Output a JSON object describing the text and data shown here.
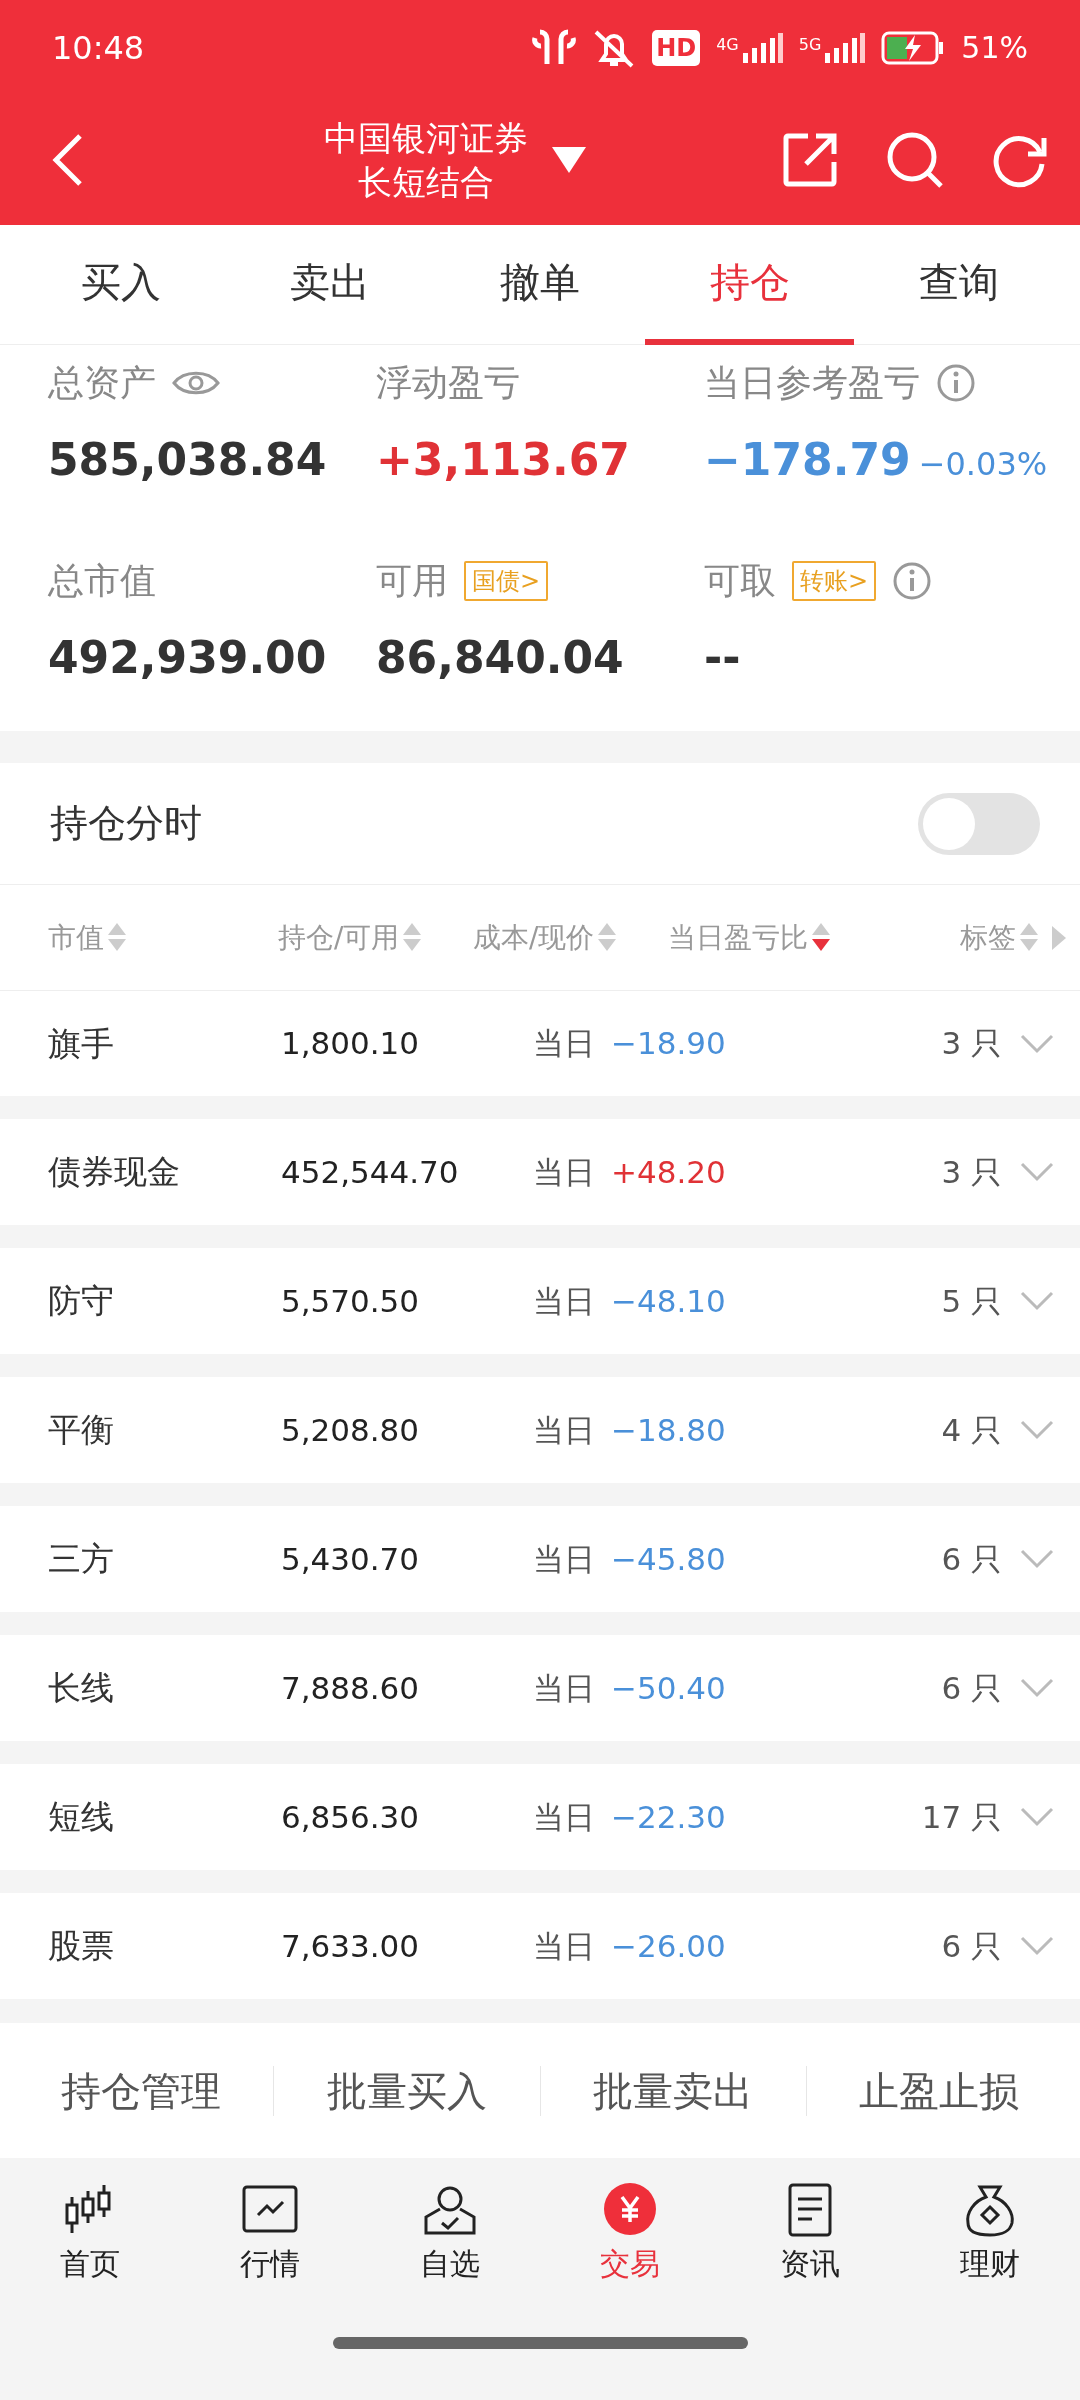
{
  "status_bar": {
    "time": "10:48",
    "hd": "HD",
    "net1": "4G",
    "net2": "5G",
    "battery": "51%"
  },
  "header": {
    "title": "中国银河证券",
    "subtitle": "长短结合"
  },
  "tabs": [
    {
      "label": "买入",
      "selected": false
    },
    {
      "label": "卖出",
      "selected": false
    },
    {
      "label": "撤单",
      "selected": false
    },
    {
      "label": "持仓",
      "selected": true
    },
    {
      "label": "查询",
      "selected": false
    }
  ],
  "summary": [
    {
      "label": "总资产",
      "value": "585,038.84"
    },
    {
      "label": "浮动盈亏",
      "value": "+3,113.67",
      "kind": "up"
    },
    {
      "label": "当日参考盈亏",
      "value": "−178.79",
      "percent": "−0.03%",
      "kind": "down"
    },
    {
      "label": "总市值",
      "value": "492,939.00"
    },
    {
      "label": "可用",
      "value": "86,840.04",
      "tag": "国债>"
    },
    {
      "label": "可取",
      "value": "--",
      "tag": "转账>"
    }
  ],
  "intraday": {
    "label": "持仓分时",
    "on": false
  },
  "table": {
    "columns": [
      {
        "label": "市值",
        "sorted": false
      },
      {
        "label": "持仓/可用",
        "sorted": false
      },
      {
        "label": "成本/现价",
        "sorted": false
      },
      {
        "label": "当日盈亏比",
        "sorted": true
      },
      {
        "label": "标签",
        "sorted": false
      }
    ],
    "rows": [
      {
        "name": "旗手",
        "amount": "1,800.10",
        "period": "当日",
        "pnl": "−18.90",
        "kind": "down",
        "count": "3 只"
      },
      {
        "name": "债券现金",
        "amount": "452,544.70",
        "period": "当日",
        "pnl": "+48.20",
        "kind": "up",
        "count": "3 只"
      },
      {
        "name": "防守",
        "amount": "5,570.50",
        "period": "当日",
        "pnl": "−48.10",
        "kind": "down",
        "count": "5 只"
      },
      {
        "name": "平衡",
        "amount": "5,208.80",
        "period": "当日",
        "pnl": "−18.80",
        "kind": "down",
        "count": "4 只"
      },
      {
        "name": "三方",
        "amount": "5,430.70",
        "period": "当日",
        "pnl": "−45.80",
        "kind": "down",
        "count": "6 只"
      },
      {
        "name": "长线",
        "amount": "7,888.60",
        "period": "当日",
        "pnl": "−50.40",
        "kind": "down",
        "count": "6 只"
      },
      {
        "name": "短线",
        "amount": "6,856.30",
        "period": "当日",
        "pnl": "−22.30",
        "kind": "down",
        "count": "17 只"
      },
      {
        "name": "股票",
        "amount": "7,633.00",
        "period": "当日",
        "pnl": "−26.00",
        "kind": "down",
        "count": "6 只"
      }
    ]
  },
  "actions": [
    "持仓管理",
    "批量买入",
    "批量卖出",
    "止盈止损"
  ],
  "nav": [
    {
      "label": "首页",
      "selected": false
    },
    {
      "label": "行情",
      "selected": false
    },
    {
      "label": "自选",
      "selected": false
    },
    {
      "label": "交易",
      "selected": true
    },
    {
      "label": "资讯",
      "selected": false
    },
    {
      "label": "理财",
      "selected": false
    }
  ]
}
